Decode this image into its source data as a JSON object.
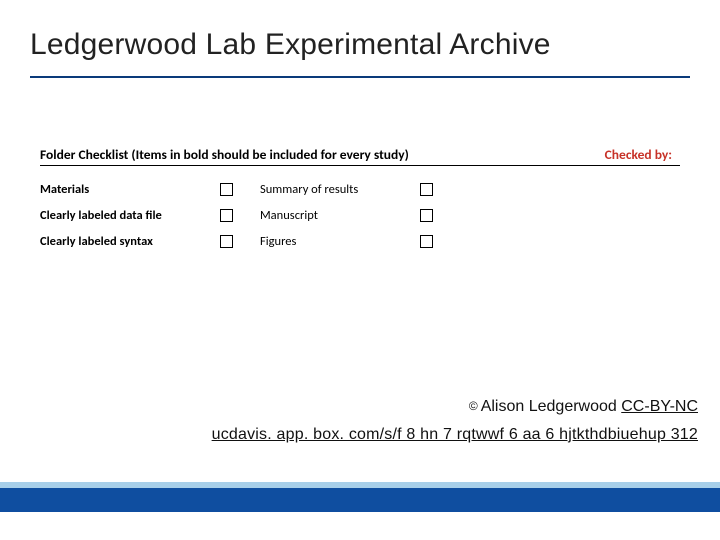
{
  "title": "Ledgerwood Lab Experimental Archive",
  "checklist": {
    "header_left": "Folder Checklist (Items in bold should be included for every study)",
    "header_right": "Checked by:",
    "rows": [
      {
        "a": "Materials",
        "a_bold": true,
        "b": "Summary of results",
        "b_bold": false
      },
      {
        "a": "Clearly labeled data file",
        "a_bold": true,
        "b": "Manuscript",
        "b_bold": false
      },
      {
        "a": "Clearly labeled syntax",
        "a_bold": true,
        "b": "Figures",
        "b_bold": false
      }
    ]
  },
  "credit": {
    "copyright_symbol": "©",
    "author": "Alison Ledgerwood",
    "license": "CC-BY-NC"
  },
  "url": "ucdavis. app. box. com/s/f 8 hn 7 rqtwwf 6 aa 6 hjtkthdbiuehup 312"
}
